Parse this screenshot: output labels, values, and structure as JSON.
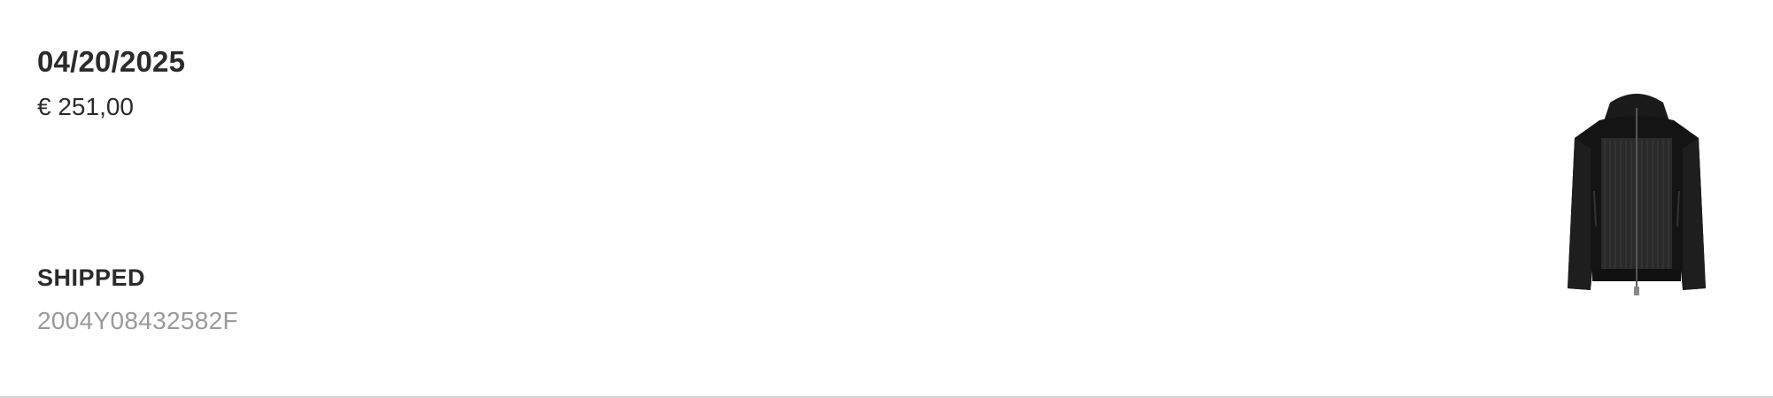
{
  "order": {
    "date": "04/20/2025",
    "price": "€ 251,00",
    "status": "SHIPPED",
    "order_number": "2004Y08432582F",
    "product_image_icon": "black-hooded-jacket-image"
  }
}
